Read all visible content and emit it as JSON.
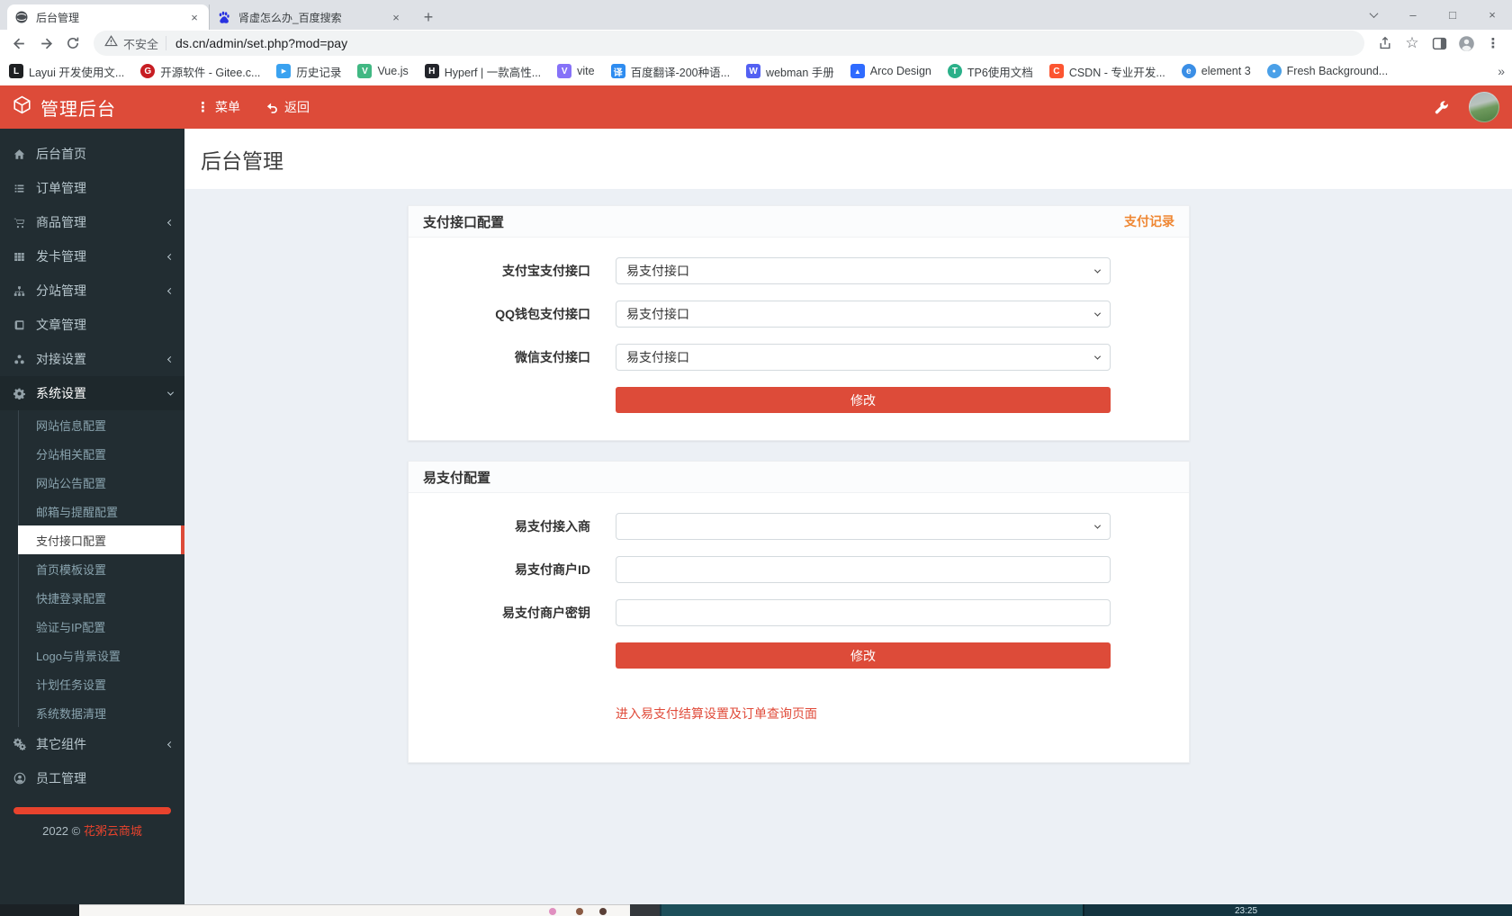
{
  "browser": {
    "tabs": [
      {
        "title": "后台管理"
      },
      {
        "title": "肾虚怎么办_百度搜索"
      }
    ],
    "address": {
      "security": "不安全",
      "url": "ds.cn/admin/set.php?mod=pay"
    },
    "bookmarks": [
      {
        "label": "Layui 开发使用文...",
        "glyph": "L",
        "color": "#1e2022"
      },
      {
        "label": "开源软件 - Gitee.c...",
        "glyph": "G",
        "color": "#c71d23"
      },
      {
        "label": "历史记录",
        "glyph": "▶",
        "color": "#3aa2f0"
      },
      {
        "label": "Vue.js",
        "glyph": "V",
        "color": "#41b883"
      },
      {
        "label": "Hyperf | 一款高性...",
        "glyph": "H",
        "color": "#22242a"
      },
      {
        "label": "vite",
        "glyph": "V",
        "color": "#8672f8"
      },
      {
        "label": "百度翻译-200种语...",
        "glyph": "译",
        "color": "#2e8cf0"
      },
      {
        "label": "webman 手册",
        "glyph": "W",
        "color": "#5360f2"
      },
      {
        "label": "Arco Design",
        "glyph": "▲",
        "color": "#2f6bff"
      },
      {
        "label": "TP6使用文档",
        "glyph": "T",
        "color": "#2bb089"
      },
      {
        "label": "CSDN - 专业开发...",
        "glyph": "C",
        "color": "#fc5531"
      },
      {
        "label": "element 3",
        "glyph": "e",
        "color": "#3a8ee6"
      },
      {
        "label": "Fresh Background...",
        "glyph": "●",
        "color": "#4aa0e8"
      }
    ],
    "overflow_chevron": "»"
  },
  "icons": {
    "close": "×",
    "minimize": "–",
    "maximize": "□",
    "plus": "+",
    "star": "☆",
    "kebab": "⋮"
  },
  "app_header": {
    "title": "管理后台",
    "menu": "菜单",
    "back": "返回"
  },
  "sidebar": {
    "items": [
      {
        "label": "后台首页",
        "has_children": false
      },
      {
        "label": "订单管理",
        "has_children": false
      },
      {
        "label": "商品管理",
        "has_children": true
      },
      {
        "label": "发卡管理",
        "has_children": true
      },
      {
        "label": "分站管理",
        "has_children": true
      },
      {
        "label": "文章管理",
        "has_children": false
      },
      {
        "label": "对接设置",
        "has_children": true
      },
      {
        "label": "系统设置",
        "has_children": true,
        "expanded": true
      }
    ],
    "submenu": [
      "网站信息配置",
      "分站相关配置",
      "网站公告配置",
      "邮箱与提醒配置",
      "支付接口配置",
      "首页模板设置",
      "快捷登录配置",
      "验证与IP配置",
      "Logo与背景设置",
      "计划任务设置",
      "系统数据清理"
    ],
    "active_submenu": "支付接口配置",
    "bottom_items": [
      {
        "label": "其它组件",
        "has_children": true
      },
      {
        "label": "员工管理",
        "has_children": false
      }
    ],
    "footer": {
      "year": "2022 ©",
      "brand": "花粥云商城"
    }
  },
  "main": {
    "page_title": "后台管理"
  },
  "panel_pay": {
    "title": "支付接口配置",
    "record_link": "支付记录",
    "fields": [
      {
        "label": "支付宝支付接口",
        "value": "易支付接口",
        "type": "select"
      },
      {
        "label": "QQ钱包支付接口",
        "value": "易支付接口",
        "type": "select"
      },
      {
        "label": "微信支付接口",
        "value": "易支付接口",
        "type": "select"
      }
    ],
    "submit": "修改"
  },
  "panel_epay": {
    "title": "易支付配置",
    "fields": [
      {
        "label": "易支付接入商",
        "value": "",
        "type": "select"
      },
      {
        "label": "易支付商户ID",
        "value": "",
        "type": "text"
      },
      {
        "label": "易支付商户密钥",
        "value": "",
        "type": "text"
      }
    ],
    "submit": "修改",
    "link": "进入易支付结算设置及订单查询页面"
  },
  "taskbar": {
    "time": "23:25"
  },
  "colors": {
    "accent": "#dd4b39",
    "record_link": "#ef8733",
    "sidebar_bg": "#222d32",
    "content_bg": "#ecf0f5"
  }
}
